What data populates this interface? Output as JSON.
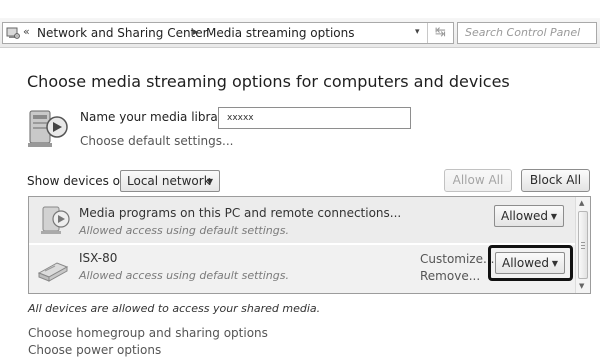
{
  "address_bar": {
    "back_chevron": "«",
    "crumbs": [
      "Network and Sharing Center",
      "Media streaming options"
    ],
    "separator": "▸",
    "dropdown_glyph": "▾",
    "refresh_glyph": "↹",
    "search_placeholder": "Search Control Panel"
  },
  "page": {
    "title": "Choose media streaming options for computers and devices",
    "library_label": "Name your media library:",
    "library_value": "xxxxx",
    "default_settings_link": "Choose default settings...",
    "show_devices_label": "Show devices on:",
    "show_devices_value": "Local network",
    "allow_all_label": "Allow All",
    "block_all_label": "Block All"
  },
  "devices": [
    {
      "title": "Media programs on this PC and remote connections...",
      "subtitle": "Allowed access using default settings.",
      "permission": "Allowed",
      "icon": "media-program-icon"
    },
    {
      "title": "ISX-80",
      "subtitle": "Allowed access using default settings.",
      "customize_label": "Customize...",
      "remove_label": "Remove...",
      "permission": "Allowed",
      "icon": "network-device-icon"
    }
  ],
  "footer": {
    "note": "All devices are allowed to access your shared media.",
    "links": [
      "Choose homegroup and sharing options",
      "Choose power options"
    ]
  },
  "colors": {
    "highlight_border": "#111111",
    "row_background": "#ececec",
    "disabled_text": "#a5a5a5"
  }
}
